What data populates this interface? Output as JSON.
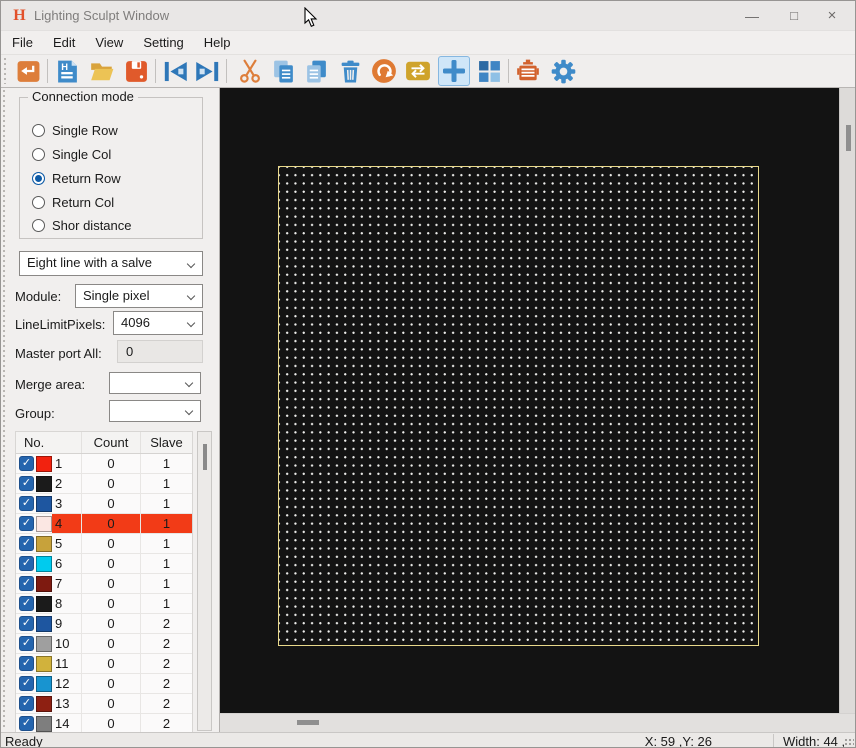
{
  "window": {
    "title": "Lighting Sculpt Window",
    "controls": {
      "minimize": "—",
      "maximize": "□",
      "close": "×"
    }
  },
  "menu": {
    "items": [
      "File",
      "Edit",
      "View",
      "Setting",
      "Help"
    ]
  },
  "toolbar": {
    "buttons": [
      "import-box",
      "new-h-file",
      "open-folder",
      "save",
      "skip-to-start",
      "skip-to-end",
      "cut",
      "copy",
      "paste",
      "delete",
      "reroute",
      "swap",
      "crosshair-plus",
      "blocks",
      "device-config",
      "settings-gear"
    ],
    "selected_button": "crosshair-plus"
  },
  "sidebar": {
    "connection_mode": {
      "label": "Connection mode",
      "options": [
        {
          "label": "Single Row",
          "selected": false
        },
        {
          "label": "Single Col",
          "selected": false
        },
        {
          "label": "Return Row",
          "selected": true
        },
        {
          "label": "Return Col",
          "selected": false
        },
        {
          "label": "Shor distance",
          "selected": false
        }
      ]
    },
    "line_mode": {
      "value": "Eight line with a salve"
    },
    "module": {
      "label": "Module:",
      "value": "Single pixel"
    },
    "line_limit": {
      "label": "LineLimitPixels:",
      "value": "4096"
    },
    "master_port": {
      "label": "Master port All:",
      "value": "0"
    },
    "merge_area": {
      "label": "Merge area:",
      "value": ""
    },
    "group": {
      "label": "Group:",
      "value": ""
    },
    "table": {
      "columns": [
        "No.",
        "Count",
        "Slave"
      ],
      "rows": [
        {
          "no": 1,
          "count": 0,
          "slave": 1,
          "color": "#f2220f",
          "checked": true,
          "selected": false
        },
        {
          "no": 2,
          "count": 0,
          "slave": 1,
          "color": "#1b1b1b",
          "checked": true,
          "selected": false
        },
        {
          "no": 3,
          "count": 0,
          "slave": 1,
          "color": "#1e56a0",
          "checked": true,
          "selected": false
        },
        {
          "no": 4,
          "count": 0,
          "slave": 1,
          "color": "#fbe7e3",
          "checked": true,
          "selected": true
        },
        {
          "no": 5,
          "count": 0,
          "slave": 1,
          "color": "#c7a23b",
          "checked": true,
          "selected": false
        },
        {
          "no": 6,
          "count": 0,
          "slave": 1,
          "color": "#00cbee",
          "checked": true,
          "selected": false
        },
        {
          "no": 7,
          "count": 0,
          "slave": 1,
          "color": "#7e1a10",
          "checked": true,
          "selected": false
        },
        {
          "no": 8,
          "count": 0,
          "slave": 1,
          "color": "#1b1b1b",
          "checked": true,
          "selected": false
        },
        {
          "no": 9,
          "count": 0,
          "slave": 2,
          "color": "#1e56a0",
          "checked": true,
          "selected": false
        },
        {
          "no": 10,
          "count": 0,
          "slave": 2,
          "color": "#9f9f9f",
          "checked": true,
          "selected": false
        },
        {
          "no": 11,
          "count": 0,
          "slave": 2,
          "color": "#d1b23c",
          "checked": true,
          "selected": false
        },
        {
          "no": 12,
          "count": 0,
          "slave": 2,
          "color": "#1894d0",
          "checked": true,
          "selected": false
        },
        {
          "no": 13,
          "count": 0,
          "slave": 2,
          "color": "#8e2012",
          "checked": true,
          "selected": false
        },
        {
          "no": 14,
          "count": 0,
          "slave": 2,
          "color": "#7e7e7e",
          "checked": true,
          "selected": false
        }
      ]
    }
  },
  "canvas": {
    "background": "#131313",
    "grid_border_color": "#e9d98b",
    "dot_color": "#f0f0ee"
  },
  "statusbar": {
    "ready": "Ready",
    "position": "X: 59 ,Y: 26",
    "size_info": "Width: 44 ,"
  },
  "colors": {
    "selection_red": "#f23b17",
    "checkbox_blue": "#2565ae",
    "accent_orange": "#dd7e3b",
    "accent_blue": "#3f8bc9"
  }
}
